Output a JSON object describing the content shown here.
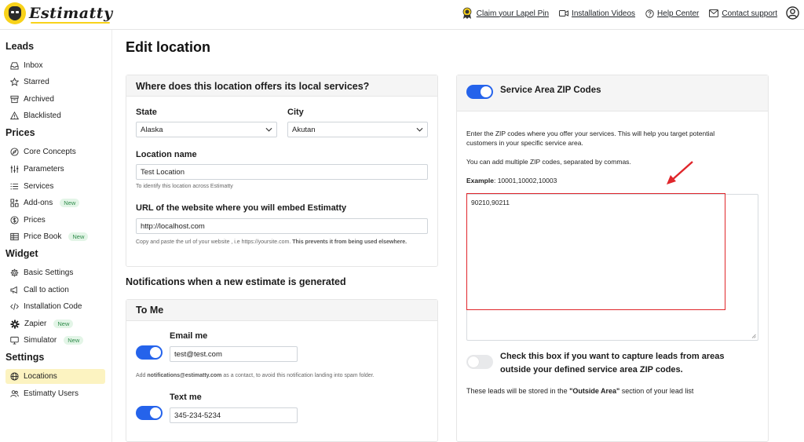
{
  "brand": {
    "name": "Estimatty"
  },
  "header": {
    "links": [
      {
        "label": "Claim your Lapel Pin",
        "icon": "award-icon"
      },
      {
        "label": "Installation Videos",
        "icon": "video-icon"
      },
      {
        "label": "Help Center",
        "icon": "help-circle-icon"
      },
      {
        "label": "Contact support",
        "icon": "mail-icon"
      }
    ]
  },
  "sidebar": {
    "sections": [
      {
        "title": "Leads",
        "items": [
          {
            "label": "Inbox",
            "icon": "inbox-icon"
          },
          {
            "label": "Starred",
            "icon": "star-icon"
          },
          {
            "label": "Archived",
            "icon": "archive-icon"
          },
          {
            "label": "Blacklisted",
            "icon": "warning-icon"
          }
        ]
      },
      {
        "title": "Prices",
        "items": [
          {
            "label": "Core Concepts",
            "icon": "compass-icon"
          },
          {
            "label": "Parameters",
            "icon": "sliders-icon"
          },
          {
            "label": "Services",
            "icon": "list-icon"
          },
          {
            "label": "Add-ons",
            "icon": "grid-plus-icon",
            "badge": "New"
          },
          {
            "label": "Prices",
            "icon": "dollar-icon"
          },
          {
            "label": "Price Book",
            "icon": "table-icon",
            "badge": "New"
          }
        ]
      },
      {
        "title": "Widget",
        "items": [
          {
            "label": "Basic Settings",
            "icon": "gear-icon"
          },
          {
            "label": "Call to action",
            "icon": "megaphone-icon"
          },
          {
            "label": "Installation Code",
            "icon": "code-icon"
          },
          {
            "label": "Zapier",
            "icon": "zapier-icon",
            "badge": "New"
          },
          {
            "label": "Simulator",
            "icon": "monitor-icon",
            "badge": "New"
          }
        ]
      },
      {
        "title": "Settings",
        "items": [
          {
            "label": "Locations",
            "icon": "globe-icon",
            "active": true
          },
          {
            "label": "Estimatty Users",
            "icon": "users-icon"
          }
        ]
      }
    ]
  },
  "page": {
    "title": "Edit location"
  },
  "location_card": {
    "heading": "Where does this location offers its local services?",
    "state_label": "State",
    "state_value": "Alaska",
    "city_label": "City",
    "city_value": "Akutan",
    "name_label": "Location name",
    "name_value": "Test Location",
    "name_hint": "To identify this location across Estimatty",
    "url_label": "URL of the website where you will embed Estimatty",
    "url_value": "http://localhost.com",
    "url_hint_prefix": "Copy and paste the url of your website , i.e https://yoursite.com.",
    "url_hint_bold": "This prevents it from being used elsewhere."
  },
  "notifications": {
    "section_title": "Notifications when a new estimate is generated",
    "card_heading": "To Me",
    "email_label": "Email me",
    "email_value": "test@test.com",
    "email_enabled": true,
    "email_hint_prefix": "Add ",
    "email_hint_bold": "notifications@estimatty.com",
    "email_hint_suffix": " as a contact, to avoid this notification landing into spam folder.",
    "text_label": "Text me",
    "text_value": "345-234-5234",
    "text_enabled": true
  },
  "zip_card": {
    "heading": "Service Area ZIP Codes",
    "enabled": true,
    "intro": "Enter the ZIP codes where you offer your services. This will help you target potential customers in your specific service area.",
    "multi_note": "You can add multiple ZIP codes, separated by commas.",
    "example_label": "Example",
    "example_value": ": 10001,10002,10003",
    "zip_value": "90210,90211",
    "outside_label": "Check this box if you want to capture leads from areas outside your defined service area ZIP codes.",
    "outside_enabled": false,
    "outside_note_prefix": "These leads will be stored in the ",
    "outside_note_bold": "\"Outside Area\"",
    "outside_note_suffix": " section of your lead list"
  },
  "colors": {
    "accent": "#2563eb",
    "brand_yellow": "#f8d21a",
    "highlight": "#e0262b",
    "active_bg": "#fcf3c1",
    "new_badge": "#2e8b4a"
  }
}
